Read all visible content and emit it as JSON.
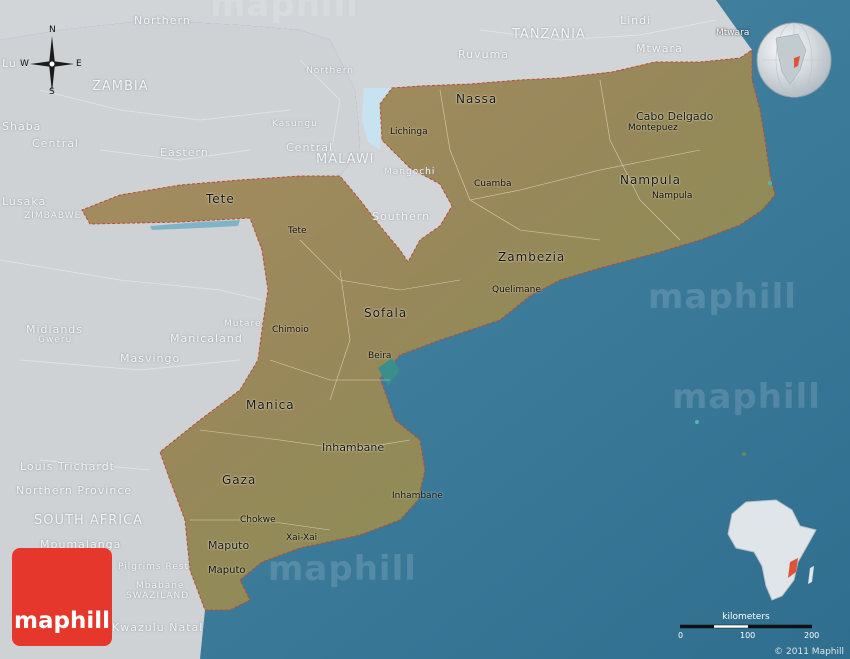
{
  "map": {
    "neighbors": {
      "northern_zambia": "Northern",
      "tanzania": "TANZANIA",
      "lindi": "Lindi",
      "mtwara_region": "Mtwara",
      "ruvuma": "Ruvuma",
      "northern_malawi": "Northern",
      "zambia": "ZAMBIA",
      "luapula": "Lu",
      "shaba": "Shaba",
      "central_zambia": "Central",
      "eastern": "Eastern",
      "central_malawi": "Central",
      "malawi": "MALAWI",
      "lusaka": "Lusaka",
      "zimbabwe": "ZIMBABWE",
      "southern_malawi": "Southern",
      "midlands": "Midlands",
      "gweru": "Gweru",
      "manicaland": "Manicaland",
      "masvingo": "Masvingo",
      "louis_trichardt": "Louis Trichardt",
      "northern_province": "Northern Province",
      "south_africa": "SOUTH AFRICA",
      "mpumalanga": "Mpumalanga",
      "pilgrims_rest": "Pilgrims Rest",
      "mbabane": "Mbabane",
      "swaziland": "SWAZILAND",
      "kwazulu_natal": "Kwazulu Natal",
      "kasungu": "Kasungu",
      "mangochi": "Mangochi",
      "mutare": "Mutare",
      "mtwara_city": "Mtwara"
    },
    "provinces": {
      "nassa": "Nassa",
      "cabo_delgado": "Cabo Delgado",
      "nampula": "Nampula",
      "tete": "Tete",
      "zambezia": "Zambezia",
      "sofala": "Sofala",
      "manica": "Manica",
      "inhambane": "Inhambane",
      "gaza": "Gaza",
      "maputo": "Maputo"
    },
    "cities": {
      "lichinga": "Lichinga",
      "montepuez": "Montepuez",
      "cuamba": "Cuamba",
      "nampula": "Nampula",
      "tete": "Tete",
      "quelimane": "Quelimane",
      "chimoio": "Chimoio",
      "beira": "Beira",
      "inhambane": "Inhambane",
      "chokwe": "Chokwe",
      "xai_xai": "Xai-Xai",
      "maputo": "Maputo"
    },
    "compass": {
      "n": "N",
      "s": "S",
      "e": "E",
      "w": "W"
    },
    "watermark": "maphill",
    "brand": "maphill",
    "scale": {
      "title": "kilometers",
      "ticks": [
        "0",
        "100",
        "200"
      ]
    },
    "copyright": "© 2011 Maphill",
    "colors": {
      "ocean": "#3e7b99",
      "land_neighbors": "#d4d7d9",
      "mozambique": "#9c8a5c",
      "brand_red": "#e6372d",
      "highlight": "#e0533a"
    }
  }
}
